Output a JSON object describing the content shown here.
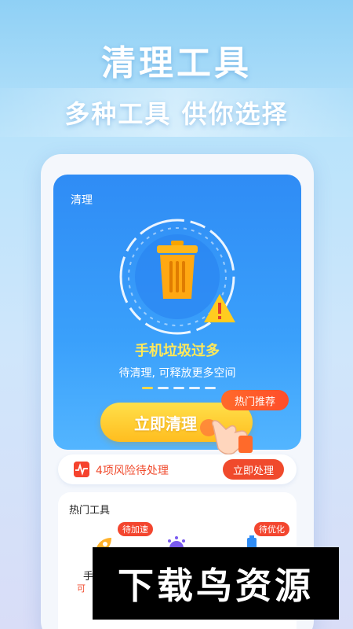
{
  "headline": "清理工具",
  "subheadline": "多种工具 供你选择",
  "hero": {
    "title": "清理",
    "status": "手机垃圾过多",
    "description": "待清理, 可释放更多空间",
    "clean_button": "立即清理",
    "hot_badge": "热门推荐"
  },
  "risk": {
    "text": "4项风险待处理",
    "button": "立即处理"
  },
  "tools": {
    "title": "热门工具",
    "tags": [
      "待加速",
      "待优化"
    ],
    "first_label": "手",
    "first_sub": "可"
  },
  "watermark": "下载鸟资源",
  "colors": {
    "accent": "#2f8cf5",
    "warning": "#f04a2c",
    "button": "#ffbd1f"
  }
}
